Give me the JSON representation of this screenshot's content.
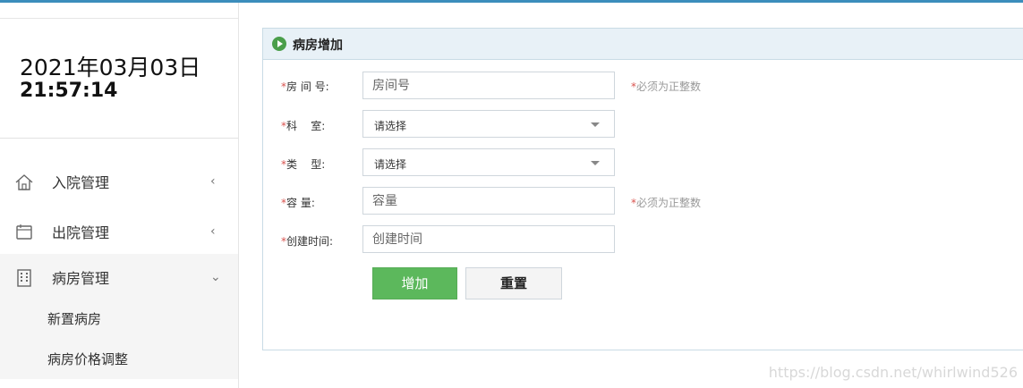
{
  "clock": {
    "date": "2021年03月03日",
    "time": "21:57:14"
  },
  "sidebar": {
    "items": [
      {
        "label": "入院管理",
        "icon": "home-icon",
        "arrow": "‹"
      },
      {
        "label": "出院管理",
        "icon": "window-icon",
        "arrow": "‹"
      },
      {
        "label": "病房管理",
        "icon": "building-icon",
        "arrow": "⌄"
      }
    ],
    "subitems": [
      {
        "label": "新置病房"
      },
      {
        "label": "病房价格调整"
      }
    ]
  },
  "panel": {
    "title": "病房增加",
    "icon": "play-circle-icon"
  },
  "form": {
    "room_no": {
      "star": "*",
      "label": "房 间 号:",
      "placeholder": "房间号",
      "hint_star": "*",
      "hint": "必须为正整数"
    },
    "department": {
      "star": "*",
      "label": "科    室:",
      "selected": "请选择"
    },
    "type": {
      "star": "*",
      "label": "类    型:",
      "selected": "请选择"
    },
    "capacity": {
      "star": "*",
      "label": "容 量:",
      "placeholder": "容量",
      "hint_star": "*",
      "hint": "必须为正整数"
    },
    "created_time": {
      "star": "*",
      "label": "创建时间:",
      "placeholder": "创建时间"
    }
  },
  "buttons": {
    "add": "增加",
    "reset": "重置"
  },
  "watermark": "https://blog.csdn.net/whirlwind526",
  "colors": {
    "accent": "#3c8dbc",
    "add_button": "#5cb85c",
    "required": "#d9534f",
    "header_bg": "#e8f1f7"
  }
}
